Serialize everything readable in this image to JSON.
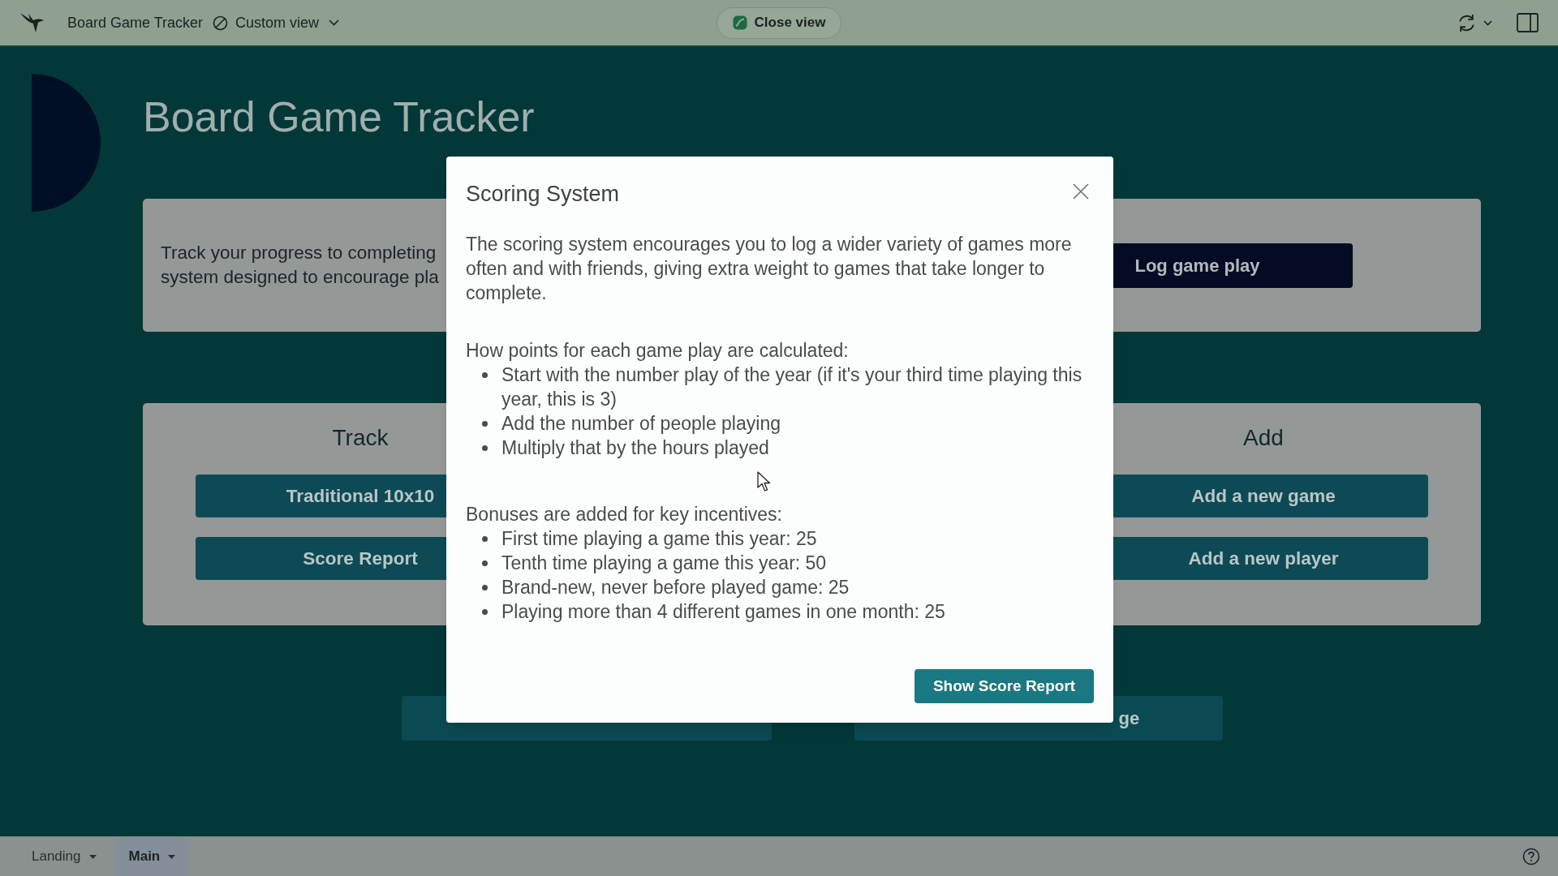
{
  "top_bar": {
    "app_name": "Board Game Tracker",
    "view_menu": "Custom view",
    "close_view": "Close view"
  },
  "page": {
    "title": "Board Game Tracker",
    "intro_lines": [
      "Track your progress to completing",
      "system designed to encourage pla"
    ],
    "log_button": "Log game play",
    "sections": [
      {
        "heading": "Track",
        "buttons": [
          "Traditional 10x10",
          "Score Report"
        ]
      },
      {
        "heading": "Add",
        "buttons": [
          "Add a new game",
          "Add a new player"
        ]
      }
    ],
    "covered_button_text": "ge"
  },
  "dialog": {
    "title": "Scoring System",
    "text": "The scoring system encourages you to log a wider variety of games more often and with friends, giving extra weight to games that take longer to complete.",
    "lists": [
      {
        "heading": "How points for each game play are calculated:",
        "items": [
          "Start with the number play of the year (if it's your third time playing this year, this is 3)",
          "Add the number of people playing",
          "Multiply that by the hours played"
        ]
      },
      {
        "heading": "Bonuses are added for key incentives:",
        "items": [
          "First time playing a game this year: 25",
          "Tenth time playing a game this year: 50",
          "Brand-new, never before played game: 25",
          "Playing more than 4 different games in one month: 25"
        ]
      }
    ],
    "button": "Show Score Report"
  },
  "sheet_tabs": [
    {
      "label": "Landing",
      "selected": false
    },
    {
      "label": "Main",
      "selected": true
    }
  ]
}
